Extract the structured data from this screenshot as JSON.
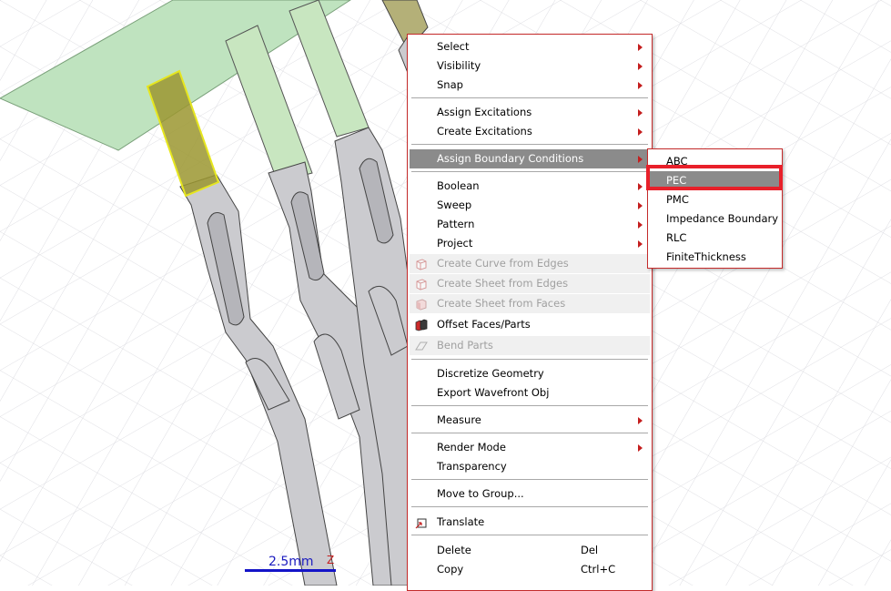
{
  "context_menu": {
    "items": [
      {
        "label": "Select",
        "submenu": true
      },
      {
        "label": "Visibility",
        "submenu": true
      },
      {
        "label": "Snap",
        "submenu": true
      },
      {
        "label": "Assign Excitations",
        "submenu": true
      },
      {
        "label": "Create Excitations",
        "submenu": true
      },
      {
        "label": "Assign Boundary Conditions",
        "submenu": true,
        "active": true
      },
      {
        "label": "Boolean",
        "submenu": true
      },
      {
        "label": "Sweep",
        "submenu": true
      },
      {
        "label": "Pattern",
        "submenu": true
      },
      {
        "label": "Project",
        "submenu": true
      },
      {
        "label": "Create Curve from Edges",
        "disabled": true,
        "icon": "cube-outline-icon"
      },
      {
        "label": "Create Sheet from Edges",
        "disabled": true,
        "icon": "cube-outline-icon"
      },
      {
        "label": "Create Sheet from Faces",
        "disabled": true,
        "icon": "cube-face-icon"
      },
      {
        "label": "Offset Faces/Parts",
        "icon": "offset-faces-icon"
      },
      {
        "label": "Bend Parts",
        "disabled": true,
        "icon": "bend-icon"
      },
      {
        "label": "Discretize Geometry"
      },
      {
        "label": "Export Wavefront Obj"
      },
      {
        "label": "Measure",
        "submenu": true
      },
      {
        "label": "Render Mode",
        "submenu": true
      },
      {
        "label": "Transparency"
      },
      {
        "label": "Move to Group..."
      },
      {
        "label": "Translate",
        "icon": "translate-icon"
      },
      {
        "label": "Delete",
        "shortcut": "Del"
      },
      {
        "label": "Copy",
        "shortcut": "Ctrl+C"
      }
    ]
  },
  "boundary_submenu": {
    "items": [
      {
        "label": "ABC"
      },
      {
        "label": "PEC",
        "active": true
      },
      {
        "label": "PMC"
      },
      {
        "label": "Impedance Boundary"
      },
      {
        "label": "RLC"
      },
      {
        "label": "FiniteThickness"
      }
    ]
  },
  "scale_bar": {
    "label": "2.5mm",
    "axis": "Z"
  },
  "colors": {
    "menu_border": "#c42a2a",
    "active_item": "#8b8b8b",
    "highlight_box": "#e8202a",
    "part_fill": "#cbcbcf",
    "sheet_fill": "#bfe3bf",
    "selected_face": "#9b9630",
    "selected_outline": "#e6e61e",
    "grid_line": "#d2d2d8",
    "scale_bar": "#1414c8"
  }
}
